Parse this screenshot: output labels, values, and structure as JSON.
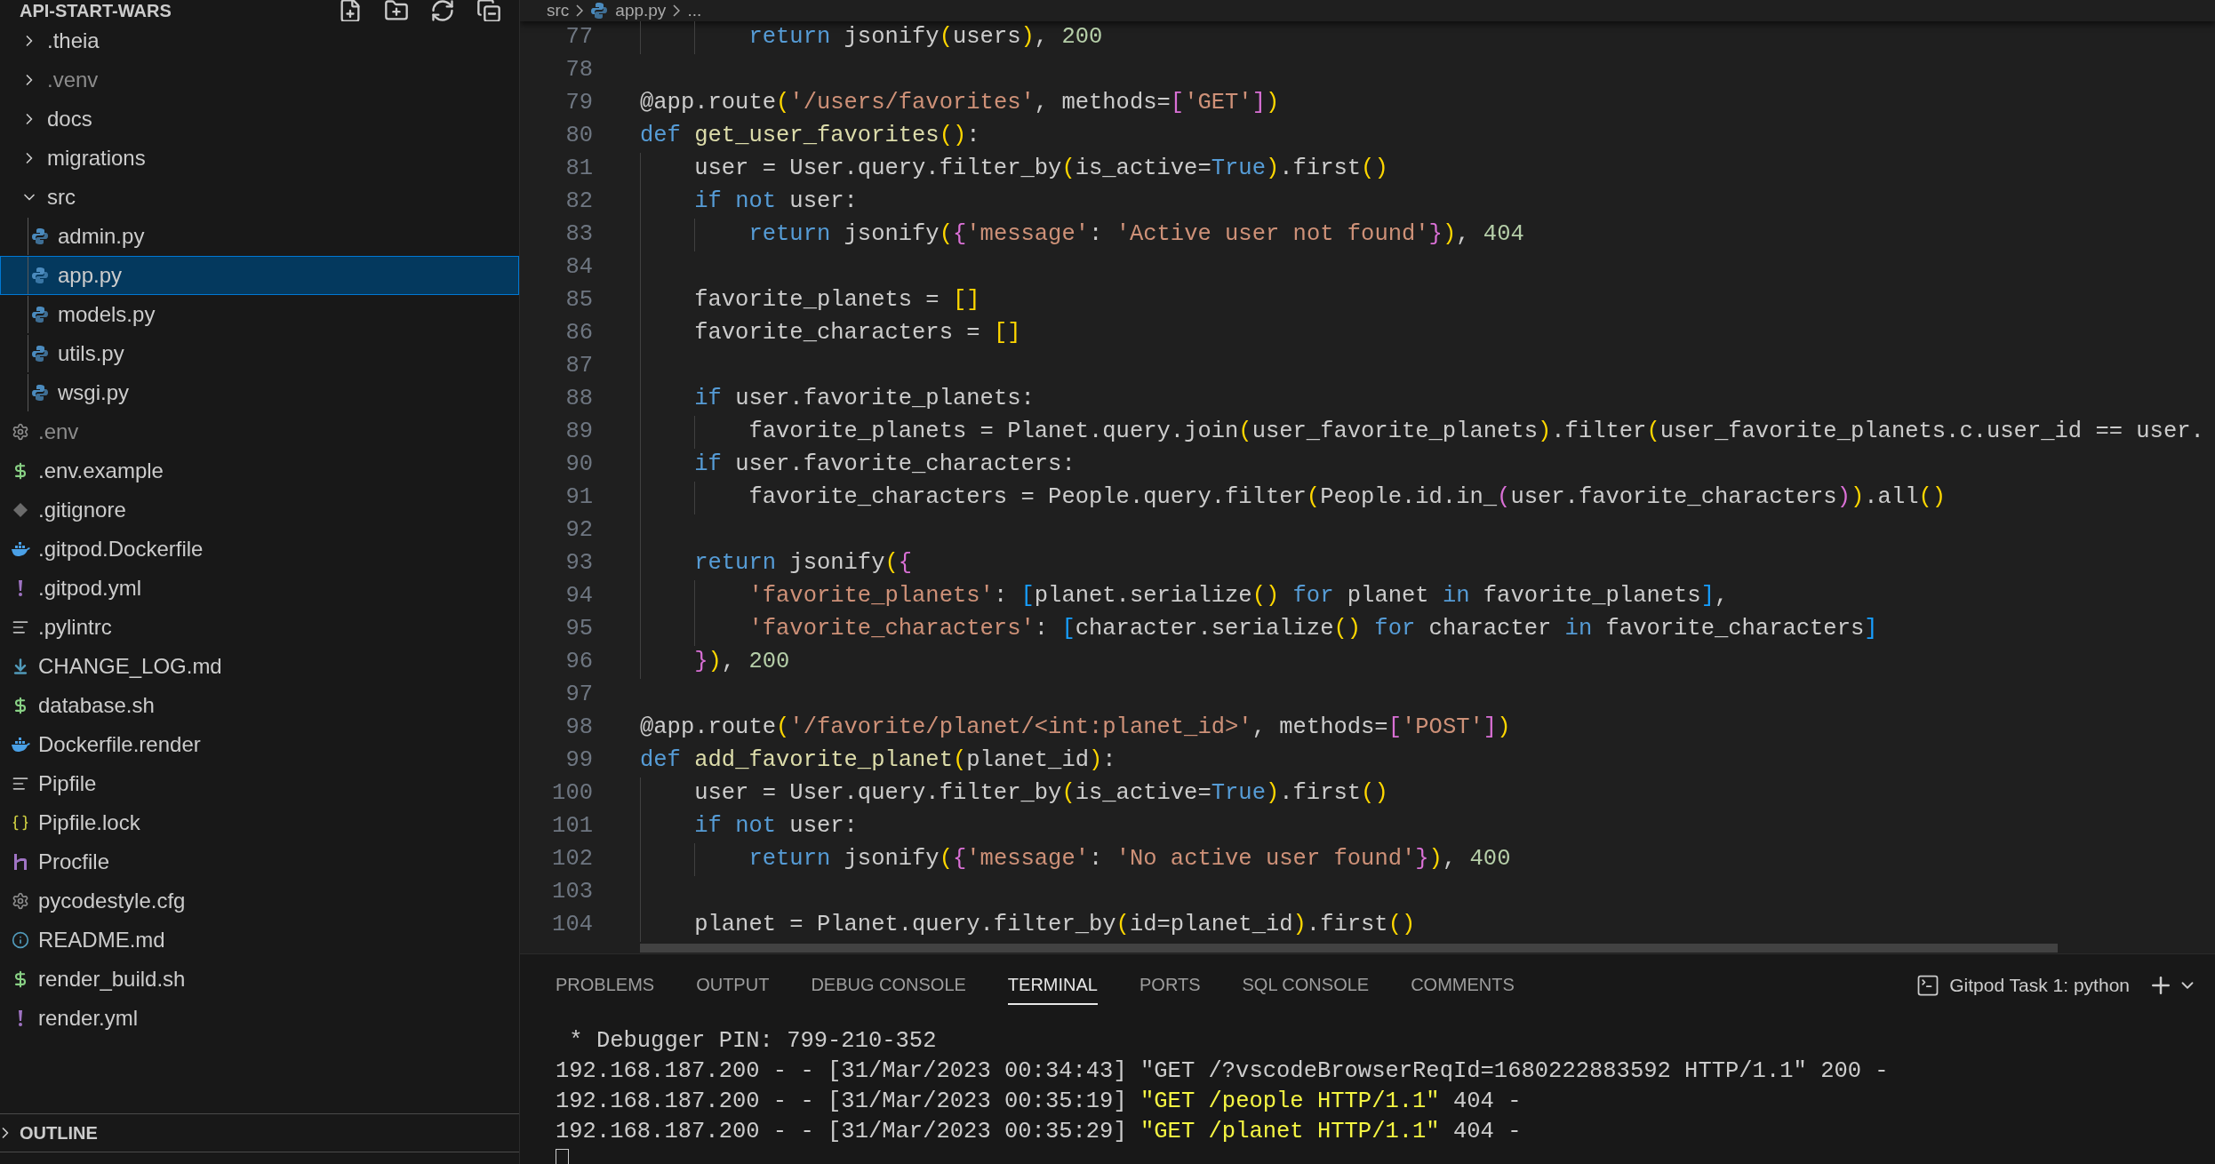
{
  "explorer": {
    "title": "API-START-WARS",
    "tree": [
      {
        "label": ".theia",
        "kind": "folder",
        "expanded": false,
        "ignored": false
      },
      {
        "label": ".venv",
        "kind": "folder",
        "expanded": false,
        "ignored": true
      },
      {
        "label": "docs",
        "kind": "folder",
        "expanded": false,
        "ignored": false
      },
      {
        "label": "migrations",
        "kind": "folder",
        "expanded": false,
        "ignored": false
      },
      {
        "label": "src",
        "kind": "folder",
        "expanded": true,
        "ignored": false,
        "children": [
          {
            "label": "admin.py",
            "kind": "python",
            "selected": false,
            "ignored": false
          },
          {
            "label": "app.py",
            "kind": "python",
            "selected": true,
            "ignored": false
          },
          {
            "label": "models.py",
            "kind": "python",
            "selected": false,
            "ignored": false
          },
          {
            "label": "utils.py",
            "kind": "python",
            "selected": false,
            "ignored": false
          },
          {
            "label": "wsgi.py",
            "kind": "python",
            "selected": false,
            "ignored": false
          }
        ]
      },
      {
        "label": ".env",
        "kind": "settings",
        "ignored": true
      },
      {
        "label": ".env.example",
        "kind": "shell",
        "ignored": false
      },
      {
        "label": ".gitignore",
        "kind": "git",
        "ignored": false
      },
      {
        "label": ".gitpod.Dockerfile",
        "kind": "docker",
        "ignored": false
      },
      {
        "label": ".gitpod.yml",
        "kind": "yaml",
        "ignored": false
      },
      {
        "label": ".pylintrc",
        "kind": "text",
        "ignored": false
      },
      {
        "label": "CHANGE_LOG.md",
        "kind": "markdown",
        "ignored": false
      },
      {
        "label": "database.sh",
        "kind": "shell",
        "ignored": false
      },
      {
        "label": "Dockerfile.render",
        "kind": "docker",
        "ignored": false
      },
      {
        "label": "Pipfile",
        "kind": "text",
        "ignored": false
      },
      {
        "label": "Pipfile.lock",
        "kind": "json",
        "ignored": false
      },
      {
        "label": "Procfile",
        "kind": "heroku",
        "ignored": false
      },
      {
        "label": "pycodestyle.cfg",
        "kind": "settings",
        "ignored": false
      },
      {
        "label": "README.md",
        "kind": "info",
        "ignored": false
      },
      {
        "label": "render_build.sh",
        "kind": "shell",
        "ignored": false
      },
      {
        "label": "render.yml",
        "kind": "yaml",
        "ignored": false
      }
    ],
    "outline": {
      "label": "OUTLINE",
      "expanded": false
    }
  },
  "breadcrumb": [
    "src",
    "app.py",
    "..."
  ],
  "editor": {
    "lines": [
      {
        "number": "77",
        "tokens": [
          {
            "kind": "keyword",
            "text": "        return"
          },
          {
            "kind": "plain",
            "text": " jsonify"
          },
          {
            "kind": "bracket1",
            "text": "("
          },
          {
            "kind": "plain",
            "text": "users"
          },
          {
            "kind": "bracket1",
            "text": ")"
          },
          {
            "kind": "plain",
            "text": ", "
          },
          {
            "kind": "number",
            "text": "200"
          }
        ]
      },
      {
        "number": "78"
      },
      {
        "number": "79",
        "tokens": [
          {
            "kind": "plain",
            "text": "@app.route"
          },
          {
            "kind": "bracket1",
            "text": "("
          },
          {
            "kind": "string",
            "text": "'/users/favorites'"
          },
          {
            "kind": "plain",
            "text": ", methods="
          },
          {
            "kind": "bracket2",
            "text": "["
          },
          {
            "kind": "string",
            "text": "'GET'"
          },
          {
            "kind": "bracket2",
            "text": "]"
          },
          {
            "kind": "bracket1",
            "text": ")"
          }
        ]
      },
      {
        "number": "80",
        "tokens": [
          {
            "kind": "keyword",
            "text": "def"
          },
          {
            "kind": "function",
            "text": " get_user_favorites"
          },
          {
            "kind": "bracket1",
            "text": "()"
          },
          {
            "kind": "plain",
            "text": ":"
          }
        ]
      },
      {
        "number": "81",
        "tokens": [
          {
            "kind": "plain",
            "text": "    user = User.query.filter_by"
          },
          {
            "kind": "bracket1",
            "text": "("
          },
          {
            "kind": "plain",
            "text": "is_active="
          },
          {
            "kind": "keyword",
            "text": "True"
          },
          {
            "kind": "bracket1",
            "text": ")"
          },
          {
            "kind": "plain",
            "text": ".first"
          },
          {
            "kind": "bracket1",
            "text": "()"
          }
        ]
      },
      {
        "number": "82",
        "tokens": [
          {
            "kind": "keyword",
            "text": "    if"
          },
          {
            "kind": "keyword",
            "text": " not"
          },
          {
            "kind": "plain",
            "text": " user:"
          }
        ]
      },
      {
        "number": "83",
        "tokens": [
          {
            "kind": "keyword",
            "text": "        return"
          },
          {
            "kind": "plain",
            "text": " jsonify"
          },
          {
            "kind": "bracket1",
            "text": "("
          },
          {
            "kind": "bracket2",
            "text": "{"
          },
          {
            "kind": "string",
            "text": "'message'"
          },
          {
            "kind": "plain",
            "text": ": "
          },
          {
            "kind": "string",
            "text": "'Active user not found'"
          },
          {
            "kind": "bracket2",
            "text": "}"
          },
          {
            "kind": "bracket1",
            "text": ")"
          },
          {
            "kind": "plain",
            "text": ", "
          },
          {
            "kind": "number",
            "text": "404"
          }
        ]
      },
      {
        "number": "84"
      },
      {
        "number": "85",
        "tokens": [
          {
            "kind": "plain",
            "text": "    favorite_planets = "
          },
          {
            "kind": "bracket1",
            "text": "[]"
          }
        ]
      },
      {
        "number": "86",
        "tokens": [
          {
            "kind": "plain",
            "text": "    favorite_characters = "
          },
          {
            "kind": "bracket1",
            "text": "[]"
          }
        ]
      },
      {
        "number": "87"
      },
      {
        "number": "88",
        "tokens": [
          {
            "kind": "keyword",
            "text": "    if"
          },
          {
            "kind": "plain",
            "text": " user.favorite_planets:"
          }
        ]
      },
      {
        "number": "89",
        "tokens": [
          {
            "kind": "plain",
            "text": "        favorite_planets = Planet.query.join"
          },
          {
            "kind": "bracket1",
            "text": "("
          },
          {
            "kind": "plain",
            "text": "user_favorite_planets"
          },
          {
            "kind": "bracket1",
            "text": ")"
          },
          {
            "kind": "plain",
            "text": ".filter"
          },
          {
            "kind": "bracket1",
            "text": "("
          },
          {
            "kind": "plain",
            "text": "user_favorite_planets.c.user_id == user."
          }
        ]
      },
      {
        "number": "90",
        "tokens": [
          {
            "kind": "keyword",
            "text": "    if"
          },
          {
            "kind": "plain",
            "text": " user.favorite_characters:"
          }
        ]
      },
      {
        "number": "91",
        "tokens": [
          {
            "kind": "plain",
            "text": "        favorite_characters = People.query.filter"
          },
          {
            "kind": "bracket1",
            "text": "("
          },
          {
            "kind": "plain",
            "text": "People.id.in_"
          },
          {
            "kind": "bracket2",
            "text": "("
          },
          {
            "kind": "plain",
            "text": "user.favorite_characters"
          },
          {
            "kind": "bracket2",
            "text": ")"
          },
          {
            "kind": "bracket1",
            "text": ")"
          },
          {
            "kind": "plain",
            "text": ".all"
          },
          {
            "kind": "bracket1",
            "text": "()"
          }
        ]
      },
      {
        "number": "92"
      },
      {
        "number": "93",
        "tokens": [
          {
            "kind": "keyword",
            "text": "    return"
          },
          {
            "kind": "plain",
            "text": " jsonify"
          },
          {
            "kind": "bracket1",
            "text": "("
          },
          {
            "kind": "bracket2",
            "text": "{"
          }
        ]
      },
      {
        "number": "94",
        "tokens": [
          {
            "kind": "string",
            "text": "        'favorite_planets'"
          },
          {
            "kind": "plain",
            "text": ": "
          },
          {
            "kind": "bracket3",
            "text": "["
          },
          {
            "kind": "plain",
            "text": "planet.serialize"
          },
          {
            "kind": "bracket1",
            "text": "()"
          },
          {
            "kind": "keyword",
            "text": " for"
          },
          {
            "kind": "plain",
            "text": " planet "
          },
          {
            "kind": "keyword",
            "text": "in"
          },
          {
            "kind": "plain",
            "text": " favorite_planets"
          },
          {
            "kind": "bracket3",
            "text": "]"
          },
          {
            "kind": "plain",
            "text": ","
          }
        ]
      },
      {
        "number": "95",
        "tokens": [
          {
            "kind": "string",
            "text": "        'favorite_characters'"
          },
          {
            "kind": "plain",
            "text": ": "
          },
          {
            "kind": "bracket3",
            "text": "["
          },
          {
            "kind": "plain",
            "text": "character.serialize"
          },
          {
            "kind": "bracket1",
            "text": "()"
          },
          {
            "kind": "keyword",
            "text": " for"
          },
          {
            "kind": "plain",
            "text": " character "
          },
          {
            "kind": "keyword",
            "text": "in"
          },
          {
            "kind": "plain",
            "text": " favorite_characters"
          },
          {
            "kind": "bracket3",
            "text": "]"
          }
        ]
      },
      {
        "number": "96",
        "tokens": [
          {
            "kind": "bracket2",
            "text": "    }"
          },
          {
            "kind": "bracket1",
            "text": ")"
          },
          {
            "kind": "plain",
            "text": ", "
          },
          {
            "kind": "number",
            "text": "200"
          }
        ]
      },
      {
        "number": "97"
      },
      {
        "number": "98",
        "tokens": [
          {
            "kind": "plain",
            "text": "@app.route"
          },
          {
            "kind": "bracket1",
            "text": "("
          },
          {
            "kind": "string",
            "text": "'/favorite/planet/<int:planet_id>'"
          },
          {
            "kind": "plain",
            "text": ", methods="
          },
          {
            "kind": "bracket2",
            "text": "["
          },
          {
            "kind": "string",
            "text": "'POST'"
          },
          {
            "kind": "bracket2",
            "text": "]"
          },
          {
            "kind": "bracket1",
            "text": ")"
          }
        ]
      },
      {
        "number": "99",
        "tokens": [
          {
            "kind": "keyword",
            "text": "def"
          },
          {
            "kind": "function",
            "text": " add_favorite_planet"
          },
          {
            "kind": "bracket1",
            "text": "("
          },
          {
            "kind": "plain",
            "text": "planet_id"
          },
          {
            "kind": "bracket1",
            "text": ")"
          },
          {
            "kind": "plain",
            "text": ":"
          }
        ]
      },
      {
        "number": "100",
        "tokens": [
          {
            "kind": "plain",
            "text": "    user = User.query.filter_by"
          },
          {
            "kind": "bracket1",
            "text": "("
          },
          {
            "kind": "plain",
            "text": "is_active="
          },
          {
            "kind": "keyword",
            "text": "True"
          },
          {
            "kind": "bracket1",
            "text": ")"
          },
          {
            "kind": "plain",
            "text": ".first"
          },
          {
            "kind": "bracket1",
            "text": "()"
          }
        ]
      },
      {
        "number": "101",
        "tokens": [
          {
            "kind": "keyword",
            "text": "    if"
          },
          {
            "kind": "keyword",
            "text": " not"
          },
          {
            "kind": "plain",
            "text": " user:"
          }
        ]
      },
      {
        "number": "102",
        "tokens": [
          {
            "kind": "keyword",
            "text": "        return"
          },
          {
            "kind": "plain",
            "text": " jsonify"
          },
          {
            "kind": "bracket1",
            "text": "("
          },
          {
            "kind": "bracket2",
            "text": "{"
          },
          {
            "kind": "string",
            "text": "'message'"
          },
          {
            "kind": "plain",
            "text": ": "
          },
          {
            "kind": "string",
            "text": "'No active user found'"
          },
          {
            "kind": "bracket2",
            "text": "}"
          },
          {
            "kind": "bracket1",
            "text": ")"
          },
          {
            "kind": "plain",
            "text": ", "
          },
          {
            "kind": "number",
            "text": "400"
          }
        ]
      },
      {
        "number": "103"
      },
      {
        "number": "104",
        "tokens": [
          {
            "kind": "plain",
            "text": "    planet = Planet.query.filter_by"
          },
          {
            "kind": "bracket1",
            "text": "("
          },
          {
            "kind": "plain",
            "text": "id=planet_id"
          },
          {
            "kind": "bracket1",
            "text": ")"
          },
          {
            "kind": "plain",
            "text": ".first"
          },
          {
            "kind": "bracket1",
            "text": "()"
          }
        ]
      }
    ]
  },
  "panel": {
    "tabs": [
      {
        "label": "PROBLEMS",
        "selected": false
      },
      {
        "label": "OUTPUT",
        "selected": false
      },
      {
        "label": "DEBUG CONSOLE",
        "selected": false
      },
      {
        "label": "TERMINAL",
        "selected": true
      },
      {
        "label": "PORTS",
        "selected": false
      },
      {
        "label": "SQL CONSOLE",
        "selected": false
      },
      {
        "label": "COMMENTS",
        "selected": false
      }
    ],
    "terminal_name": "Gitpod Task 1: python",
    "terminal_lines": [
      [
        {
          "kind": "plain",
          "text": " * Debugger PIN: 799-210-352"
        }
      ],
      [
        {
          "kind": "plain",
          "text": "192.168.187.200 - - [31/Mar/2023 00:34:43] \"GET /?vscodeBrowserReqId=1680222883592 HTTP/1.1\" 200 -"
        }
      ],
      [
        {
          "kind": "plain",
          "text": "192.168.187.200 - - [31/Mar/2023 00:35:19] "
        },
        {
          "kind": "highlight",
          "text": "\"GET /people HTTP/1.1\""
        },
        {
          "kind": "plain",
          "text": " 404 -"
        }
      ],
      [
        {
          "kind": "plain",
          "text": "192.168.187.200 - - [31/Mar/2023 00:35:29] "
        },
        {
          "kind": "highlight",
          "text": "\"GET /planet HTTP/1.1\""
        },
        {
          "kind": "plain",
          "text": " 404 -"
        }
      ]
    ]
  }
}
